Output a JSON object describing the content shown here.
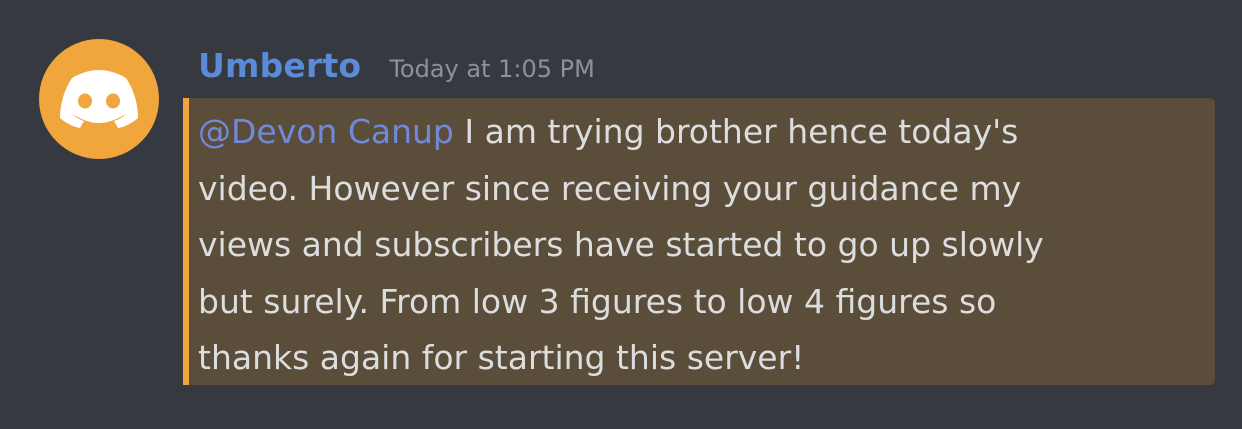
{
  "message": {
    "author": "Umberto",
    "timestamp": "Today at 1:05 PM",
    "avatar_icon": "discord-logo-icon",
    "mention": "@Devon Canup",
    "lines": [
      " I am trying brother hence today's",
      "video. However since receiving your guidance my",
      "views and subscribers have started to go up slowly",
      "but surely. From low 3 figures to low 4 figures so",
      "thanks again for starting this server!"
    ]
  },
  "colors": {
    "background": "#36393f",
    "username": "#5a8bd6",
    "timestamp": "#8e9297",
    "highlight": "#5a4d39",
    "accent": "#f0a63c",
    "mention": "#7289da",
    "text": "#dcddde"
  }
}
